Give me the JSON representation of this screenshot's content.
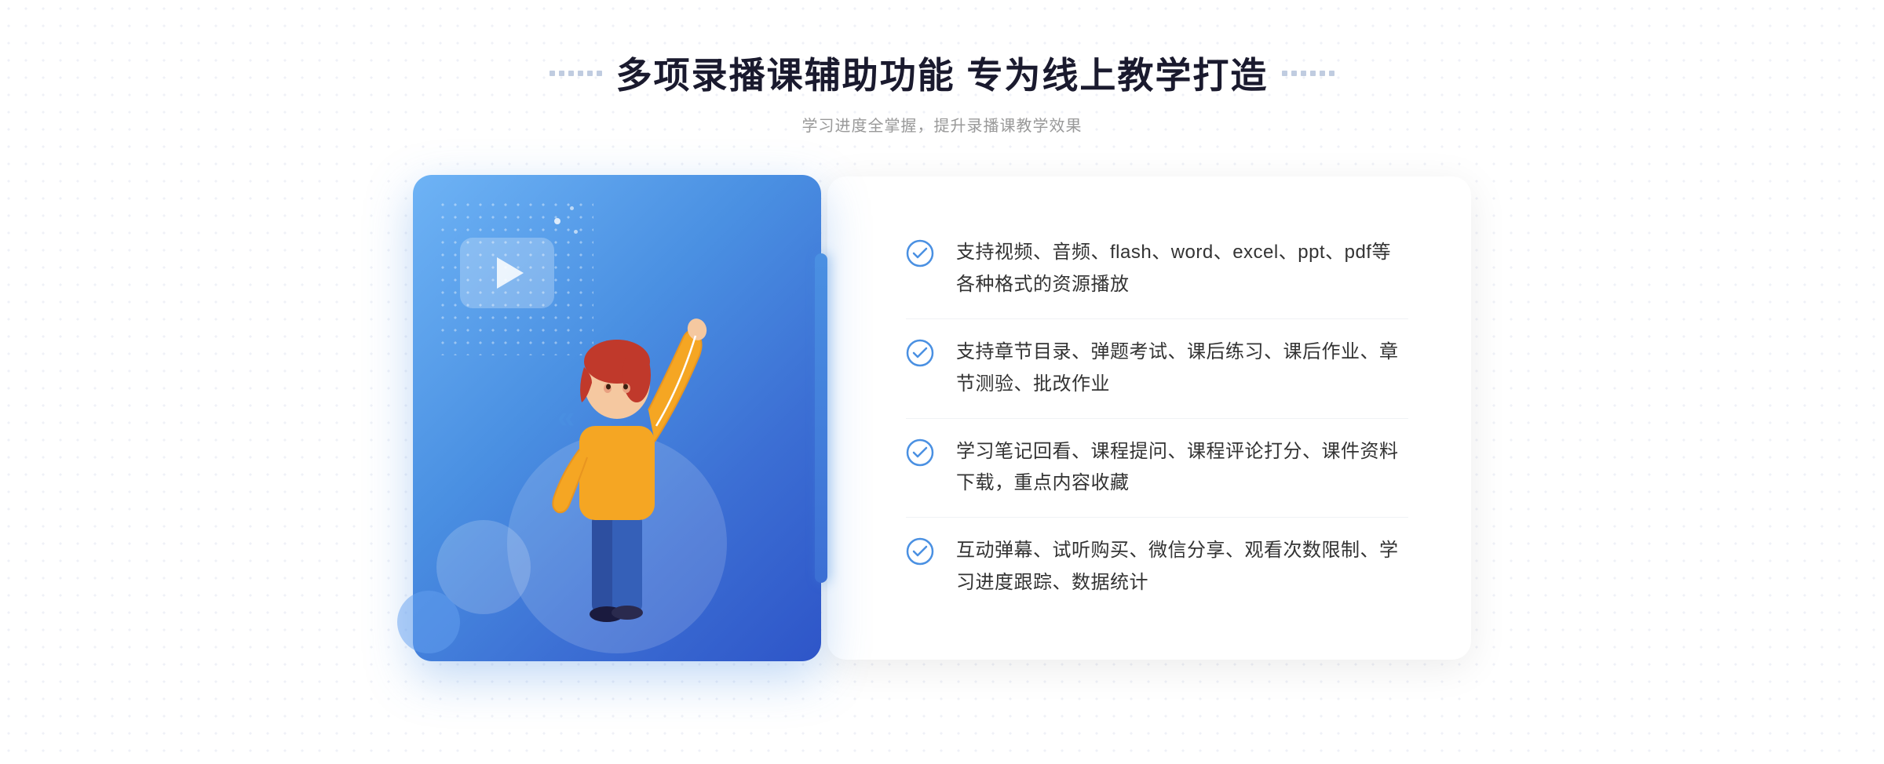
{
  "header": {
    "title": "多项录播课辅助功能 专为线上教学打造",
    "subtitle": "学习进度全掌握，提升录播课教学效果",
    "left_dots_label": "decorative-dots-left",
    "right_dots_label": "decorative-dots-right"
  },
  "features": [
    {
      "id": 1,
      "text": "支持视频、音频、flash、word、excel、ppt、pdf等各种格式的资源播放"
    },
    {
      "id": 2,
      "text": "支持章节目录、弹题考试、课后练习、课后作业、章节测验、批改作业"
    },
    {
      "id": 3,
      "text": "学习笔记回看、课程提问、课程评论打分、课件资料下载，重点内容收藏"
    },
    {
      "id": 4,
      "text": "互动弹幕、试听购买、微信分享、观看次数限制、学习进度跟踪、数据统计"
    }
  ],
  "colors": {
    "primary_blue": "#4a90e2",
    "dark_blue": "#2e55c8",
    "light_blue": "#b8d4f5",
    "check_blue": "#4a90e2",
    "text_dark": "#333333",
    "text_gray": "#999999",
    "title_color": "#1a1a2e"
  },
  "icons": {
    "check": "check-circle-icon",
    "play": "play-icon",
    "chevron": "chevron-icon"
  }
}
